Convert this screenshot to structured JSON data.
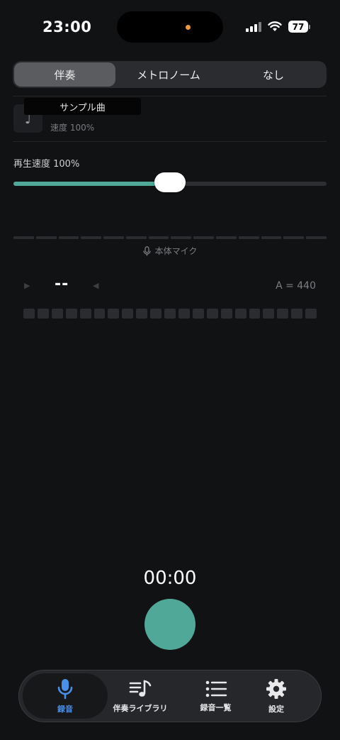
{
  "status_bar": {
    "time": "23:00",
    "battery": "77"
  },
  "segment": {
    "tabs": [
      "伴奏",
      "メトロノーム",
      "なし"
    ],
    "active_index": 0
  },
  "track": {
    "title": "サンプル曲",
    "subtitle": "速度 100%"
  },
  "speed": {
    "label": "再生速度 100%",
    "value_percent": 100,
    "slider_fraction": 0.5
  },
  "mic": {
    "source_label": "本体マイク"
  },
  "tuner": {
    "note": "--",
    "reference": "A = 440"
  },
  "recording": {
    "elapsed": "00:00"
  },
  "tabbar": {
    "items": [
      {
        "label": "録音",
        "icon": "mic-icon",
        "active": true
      },
      {
        "label": "伴奏ライブラリ",
        "icon": "music-list-icon",
        "active": false
      },
      {
        "label": "録音一覧",
        "icon": "list-icon",
        "active": false
      },
      {
        "label": "設定",
        "icon": "gear-icon",
        "active": false
      }
    ]
  },
  "colors": {
    "accent": "#4fa898",
    "active_tab": "#4a8fe8",
    "background": "#111214"
  }
}
